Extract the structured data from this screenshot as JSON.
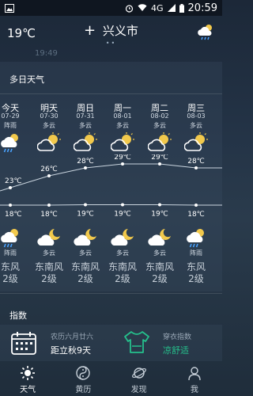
{
  "status_bar": {
    "signal": "4G",
    "time": "20:59"
  },
  "header": {
    "current_temp": "19℃",
    "city": "兴义市",
    "add_icon": "plus-icon",
    "weather_icon": "rain-cloud-icon"
  },
  "faint_time": "19:49",
  "forecast": {
    "title": "多日天气",
    "days": [
      {
        "name": "今天",
        "date": "07-29",
        "day_cond": "阵雨",
        "high": "23℃",
        "low": "18℃",
        "night_cond": "阵雨",
        "wind": "东风",
        "wind_level": "2级",
        "day_icon": "rain-icon",
        "night_icon": "rain-icon"
      },
      {
        "name": "明天",
        "date": "07-30",
        "day_cond": "多云",
        "high": "26℃",
        "low": "18℃",
        "night_cond": "多云",
        "wind": "东南风",
        "wind_level": "2级",
        "day_icon": "partly-cloudy-icon",
        "night_icon": "moon-cloud-icon"
      },
      {
        "name": "周日",
        "date": "07-31",
        "day_cond": "多云",
        "high": "28℃",
        "low": "19℃",
        "night_cond": "多云",
        "wind": "东南风",
        "wind_level": "2级",
        "day_icon": "partly-cloudy-icon",
        "night_icon": "moon-cloud-icon"
      },
      {
        "name": "周一",
        "date": "08-01",
        "day_cond": "多云",
        "high": "29℃",
        "low": "19℃",
        "night_cond": "多云",
        "wind": "东南风",
        "wind_level": "2级",
        "day_icon": "partly-cloudy-icon",
        "night_icon": "moon-cloud-icon"
      },
      {
        "name": "周二",
        "date": "08-02",
        "day_cond": "多云",
        "high": "29℃",
        "low": "19℃",
        "night_cond": "多云",
        "wind": "东南风",
        "wind_level": "2级",
        "day_icon": "partly-cloudy-icon",
        "night_icon": "moon-cloud-icon"
      },
      {
        "name": "周三",
        "date": "08-03",
        "day_cond": "多云",
        "high": "28℃",
        "low": "18℃",
        "night_cond": "阵雨",
        "wind": "东风",
        "wind_level": "2级",
        "day_icon": "partly-cloudy-icon",
        "night_icon": "rain-icon"
      }
    ]
  },
  "index": {
    "title": "指数",
    "lunar": "农历六月廿六",
    "solar_term": "距立秋9天",
    "clothing_label": "穿衣指数",
    "clothing_value": "凉舒适"
  },
  "nav": [
    {
      "label": "天气",
      "icon": "sun-icon"
    },
    {
      "label": "黄历",
      "icon": "yin-yang-icon"
    },
    {
      "label": "发现",
      "icon": "planet-icon"
    },
    {
      "label": "我",
      "icon": "person-icon"
    }
  ],
  "colors": {
    "accent_green": "#25c08c",
    "rain_blue": "#4aa3ff"
  }
}
